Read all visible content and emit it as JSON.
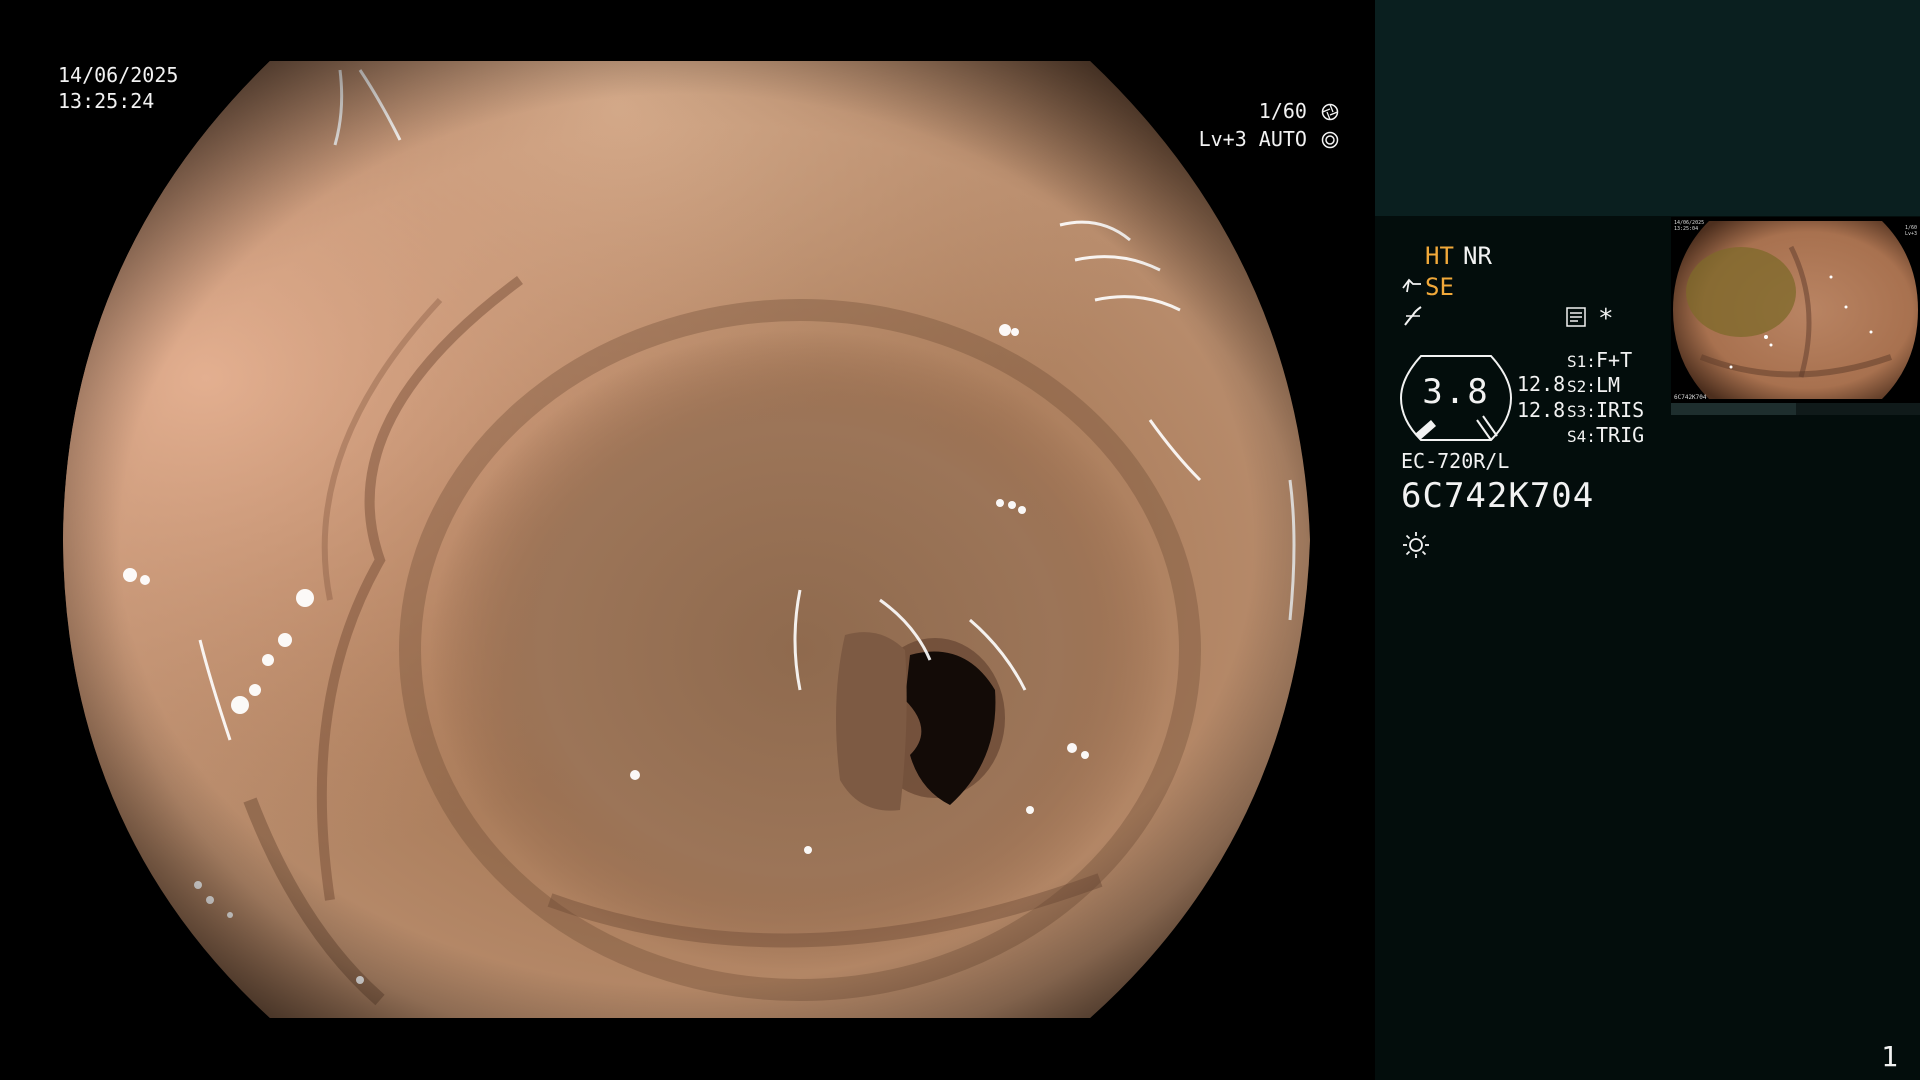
{
  "overlay": {
    "date": "14/06/2025",
    "time": "13:25:24",
    "shutter": "1/60",
    "exposure": "Lv+3 AUTO",
    "shutter_icon": "aperture-icon",
    "exposure_icon": "iris-icon"
  },
  "panel": {
    "ht": "HT",
    "nr": "NR",
    "se": "SE",
    "se_icon": "hand-suction-icon",
    "curve_icon": "enhancement-curve-icon",
    "memo_icon": "memo-icon",
    "asterisk": "*",
    "gauge_value": "3.8",
    "num1": "12.8",
    "num2": "12.8",
    "switches": [
      {
        "label": "S1:",
        "value": "F+T"
      },
      {
        "label": "S2:",
        "value": "LM"
      },
      {
        "label": "S3:",
        "value": "IRIS"
      },
      {
        "label": "S4:",
        "value": "TRIG"
      }
    ],
    "scope_model": "EC-720R/L",
    "serial": "6C742K704",
    "light_icon": "light-source-icon",
    "page_number": "1"
  },
  "thumbnail": {
    "date": "14/06/2025",
    "time": "13:25:04",
    "serial": "6C742K704",
    "shutter": "1/60",
    "exposure": "Lv+3"
  },
  "colors": {
    "panel_bg": "#030d0c",
    "panel_top_bg": "#0a1f1f",
    "accent_orange": "#f1a93a",
    "text": "#f2f2f2"
  }
}
